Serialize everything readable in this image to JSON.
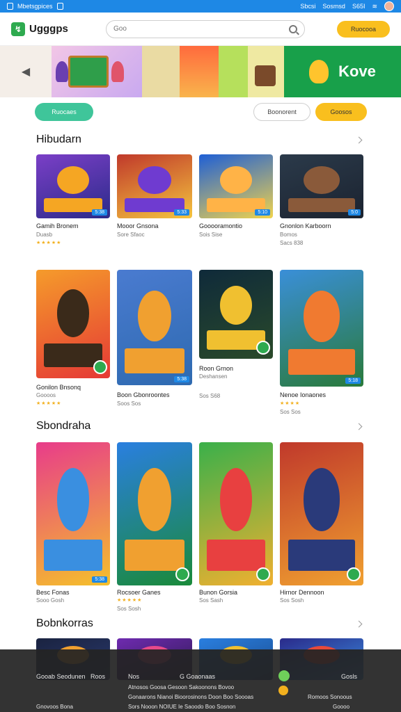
{
  "status_bar": {
    "app_label": "Mbetsgpices",
    "right_items": [
      "Sbcsi",
      "Sosmsd",
      "S65I"
    ]
  },
  "header": {
    "logo_text": "Ugggps",
    "search_placeholder": "Goo",
    "cta_label": "Ruocooa"
  },
  "banner": {
    "text": "Kove"
  },
  "actions": {
    "primary": "Ruocaes",
    "secondary": "Boonorent",
    "tertiary": "Goosos"
  },
  "sections": [
    {
      "title": "Hibudarn",
      "cards": [
        {
          "title": "Gamih Bronem",
          "subtitle": "Duasb",
          "meta": "",
          "rating": "★★★★★",
          "tag": "5:38",
          "colors": [
            "#7b3fc7",
            "#f5a623",
            "#2b2b8a"
          ]
        },
        {
          "title": "Mooor Gnsona",
          "subtitle": "Sore Sfaoc",
          "meta": "",
          "rating": "",
          "tag": "5:33",
          "colors": [
            "#c0392b",
            "#6f3bd0",
            "#f4c43e"
          ]
        },
        {
          "title": "Gooooramontio",
          "subtitle": "Sois Sise",
          "meta": "",
          "rating": "",
          "tag": "5:10",
          "colors": [
            "#1e5fd6",
            "#ffb347",
            "#f0d34c"
          ]
        },
        {
          "title": "Gnonlon Karboorn",
          "subtitle": "Bomos",
          "meta": "Sacs 838",
          "rating": "",
          "tag": "5:0",
          "colors": [
            "#2b3a4a",
            "#8a5a3a",
            "#1b2330"
          ]
        }
      ]
    },
    {
      "title": "",
      "cards": [
        {
          "title": "Gonilon Bnsonq",
          "subtitle": "Goooos",
          "meta": "",
          "rating": "★★★★★",
          "tag": "",
          "colors": [
            "#f59b2b",
            "#3a2a1a",
            "#e53935"
          ]
        },
        {
          "title": "Boon Gbonroontes",
          "subtitle": "Soos Sos",
          "meta": "",
          "rating": "",
          "tag": "5:38",
          "colors": [
            "#4a7bd0",
            "#f0a030",
            "#2e6ab0"
          ]
        },
        {
          "title": "Roon Grnon",
          "subtitle": "Deshansen",
          "meta": "Sos S68",
          "rating": "",
          "tag": "",
          "colors": [
            "#0f2a3a",
            "#f0c030",
            "#2a4a2a"
          ]
        },
        {
          "title": "Nenoe Ionaones",
          "subtitle": "Sos Sos",
          "meta": "",
          "rating": "★★★★",
          "tag": "5:18",
          "colors": [
            "#3a8fd8",
            "#f07a30",
            "#2a7a3a"
          ]
        }
      ]
    },
    {
      "title": "Sbondraha",
      "cards": [
        {
          "title": "Besc Fonas",
          "subtitle": "Sooo Gosh",
          "meta": "",
          "rating": "",
          "tag": "5:38",
          "colors": [
            "#e83c8a",
            "#3a8fe0",
            "#f5c02b"
          ]
        },
        {
          "title": "Rocsoer Ganes",
          "subtitle": "Sos Sosh",
          "meta": "",
          "rating": "★★★★★",
          "tag": "",
          "colors": [
            "#2a7fe0",
            "#f0a030",
            "#1a8a3a"
          ]
        },
        {
          "title": "Bunon Gorsia",
          "subtitle": "Sos Sash",
          "meta": "",
          "rating": "",
          "tag": "",
          "colors": [
            "#3ab04a",
            "#e84040",
            "#f0b030"
          ]
        },
        {
          "title": "Hirnor Dennoon",
          "subtitle": "Sos Sosh",
          "meta": "",
          "rating": "",
          "tag": "",
          "colors": [
            "#c0392b",
            "#2a3a7a",
            "#f0a030"
          ]
        }
      ]
    },
    {
      "title": "Bobnkorras",
      "cards": [
        {
          "title": "",
          "subtitle": "",
          "meta": "",
          "rating": "",
          "tag": "",
          "colors": [
            "#1a2340",
            "#f0a030",
            "#2a3a70"
          ]
        },
        {
          "title": "",
          "subtitle": "",
          "meta": "",
          "rating": "",
          "tag": "",
          "colors": [
            "#6f2bb0",
            "#e84a8a",
            "#2b1a50"
          ]
        },
        {
          "title": "",
          "subtitle": "",
          "meta": "",
          "rating": "",
          "tag": "",
          "colors": [
            "#2a7fe0",
            "#f0c030",
            "#1a4a8a"
          ]
        },
        {
          "title": "",
          "subtitle": "",
          "meta": "",
          "rating": "",
          "tag": "",
          "colors": [
            "#2a2a8a",
            "#e84a3a",
            "#3a8fe0"
          ]
        }
      ]
    }
  ],
  "footer": {
    "row1": {
      "col1": "Gooab Seodunen",
      "col2": "Roos",
      "col3": "Nos",
      "col4": "G Goaonaas",
      "col5": "Gosls"
    },
    "row2": {
      "text": "Atnosos Goosa Gesoon Sakoonons Bovoo"
    },
    "row3": {
      "left": "Gonaarons Nianoi Bioorosinons Doon Boo Soooas",
      "right": "Romoos Sonoous"
    },
    "row4": {
      "left": "Gnovoos Bona",
      "middle": "Sors Nooon NOIUE Ie Saoodo Boo Sosnon",
      "right": "Goooo"
    }
  }
}
